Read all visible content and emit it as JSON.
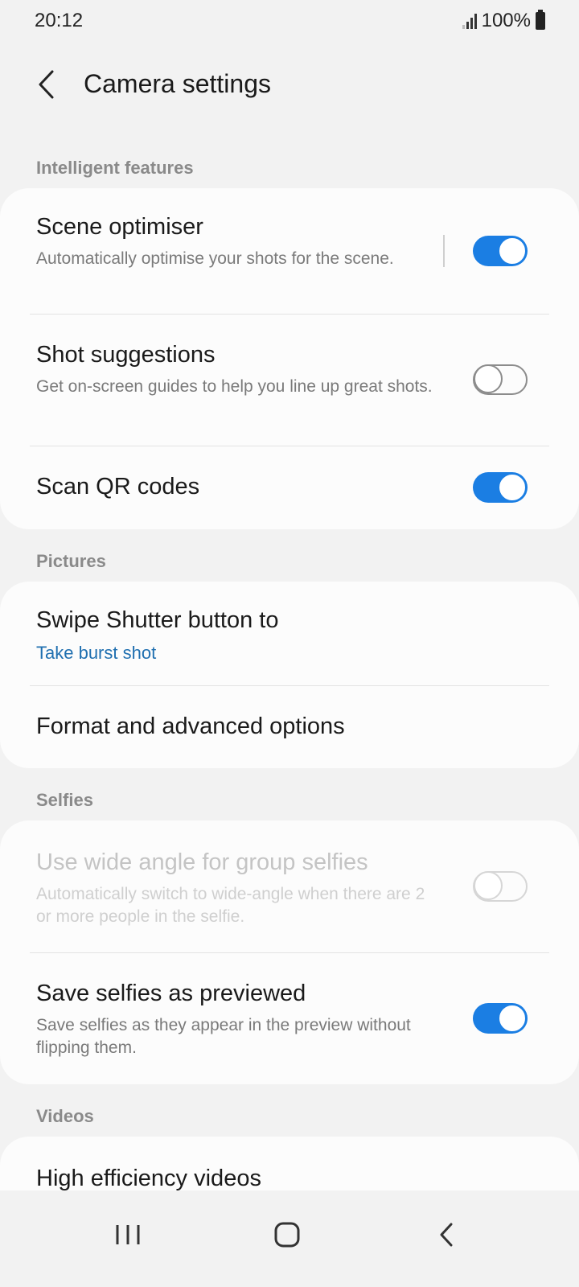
{
  "status_bar": {
    "time": "20:12",
    "battery": "100%"
  },
  "header": {
    "title": "Camera settings"
  },
  "sections": {
    "intelligent": {
      "header": "Intelligent features",
      "scene": {
        "title": "Scene optimiser",
        "subtitle": "Automatically optimise your shots for the scene.",
        "enabled": true
      },
      "shot": {
        "title": "Shot suggestions",
        "subtitle": "Get on-screen guides to help you line up great shots.",
        "enabled": false
      },
      "qr": {
        "title": "Scan QR codes",
        "enabled": true
      }
    },
    "pictures": {
      "header": "Pictures",
      "swipe": {
        "title": "Swipe Shutter button to",
        "value": "Take burst shot"
      },
      "format": {
        "title": "Format and advanced options"
      }
    },
    "selfies": {
      "header": "Selfies",
      "wide": {
        "title": "Use wide angle for group selfies",
        "subtitle": "Automatically switch to wide-angle when there are 2 or more people in the selfie.",
        "enabled": false,
        "disabled": true
      },
      "save": {
        "title": "Save selfies as previewed",
        "subtitle": "Save selfies as they appear in the preview without flipping them.",
        "enabled": true
      }
    },
    "videos": {
      "header": "Videos",
      "hev": {
        "title": "High efficiency videos"
      }
    }
  },
  "colors": {
    "accent": "#1b7ee3",
    "link": "#1f6fb0",
    "background": "#f2f2f2",
    "card": "#fcfcfc"
  },
  "icons": {
    "back": "chevron-left-icon",
    "recents": "recents-icon",
    "home": "home-icon",
    "nav_back": "back-icon"
  }
}
